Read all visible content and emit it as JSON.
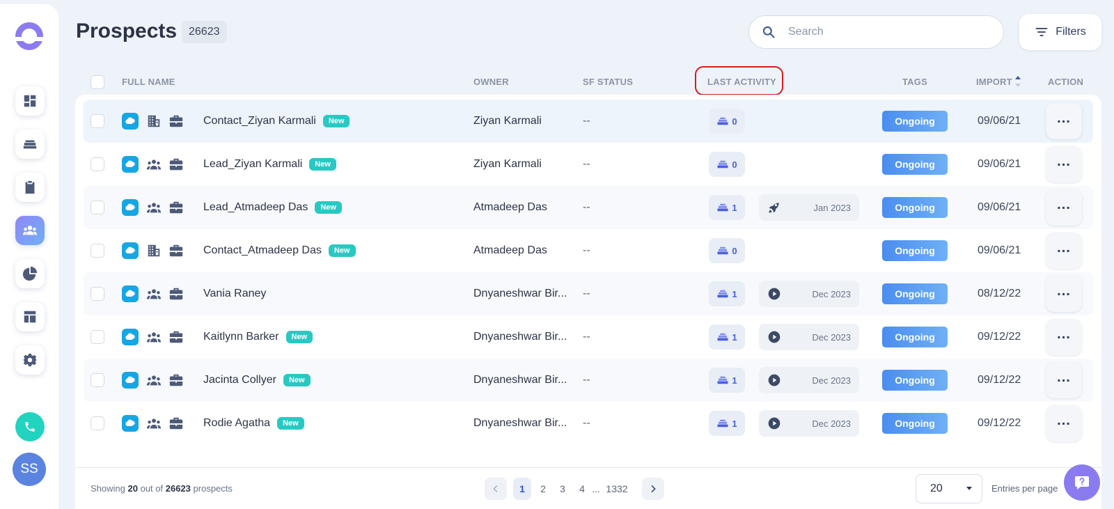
{
  "header": {
    "title": "Prospects",
    "count": "26623",
    "search_placeholder": "Search",
    "filters_label": "Filters"
  },
  "sidebar": {
    "items": [
      {
        "icon": "dashboard-icon",
        "active": false
      },
      {
        "icon": "stack-icon",
        "active": false
      },
      {
        "icon": "clipboard-icon",
        "active": false
      },
      {
        "icon": "people-icon",
        "active": true
      },
      {
        "icon": "pie-chart-icon",
        "active": false
      },
      {
        "icon": "layout-icon",
        "active": false
      },
      {
        "icon": "gear-icon",
        "active": false
      }
    ],
    "avatar_initials": "SS"
  },
  "table": {
    "columns": {
      "full_name": "FULL NAME",
      "owner": "OWNER",
      "sf_status": "SF STATUS",
      "last_activity": "LAST ACTIVITY",
      "tags": "TAGS",
      "import": "IMPORT",
      "action": "ACTION"
    },
    "new_label": "New",
    "rows": [
      {
        "type": "contact",
        "name": "Contact_Ziyan Karmali",
        "is_new": true,
        "owner": "Ziyan Karmali",
        "sf_status": "--",
        "activity_count": "0",
        "last_activity": "",
        "last_activity_icon": "",
        "tag": "Ongoing",
        "import": "09/06/21"
      },
      {
        "type": "lead",
        "name": "Lead_Ziyan Karmali",
        "is_new": true,
        "owner": "Ziyan Karmali",
        "sf_status": "--",
        "activity_count": "0",
        "last_activity": "",
        "last_activity_icon": "",
        "tag": "Ongoing",
        "import": "09/06/21"
      },
      {
        "type": "lead",
        "name": "Lead_Atmadeep Das",
        "is_new": true,
        "owner": "Atmadeep Das",
        "sf_status": "--",
        "activity_count": "1",
        "last_activity": "Jan 2023",
        "last_activity_icon": "rocket-icon",
        "tag": "Ongoing",
        "import": "09/06/21"
      },
      {
        "type": "contact",
        "name": "Contact_Atmadeep Das",
        "is_new": true,
        "owner": "Atmadeep Das",
        "sf_status": "--",
        "activity_count": "0",
        "last_activity": "",
        "last_activity_icon": "",
        "tag": "Ongoing",
        "import": "09/06/21"
      },
      {
        "type": "lead",
        "name": "Vania Raney",
        "is_new": false,
        "owner": "Dnyaneshwar Bir...",
        "sf_status": "--",
        "activity_count": "1",
        "last_activity": "Dec 2023",
        "last_activity_icon": "play-icon",
        "tag": "Ongoing",
        "import": "08/12/22"
      },
      {
        "type": "lead",
        "name": "Kaitlynn Barker",
        "is_new": true,
        "owner": "Dnyaneshwar Bir...",
        "sf_status": "--",
        "activity_count": "1",
        "last_activity": "Dec 2023",
        "last_activity_icon": "play-icon",
        "tag": "Ongoing",
        "import": "09/12/22"
      },
      {
        "type": "lead",
        "name": "Jacinta Collyer",
        "is_new": true,
        "owner": "Dnyaneshwar Bir...",
        "sf_status": "--",
        "activity_count": "1",
        "last_activity": "Dec 2023",
        "last_activity_icon": "play-icon",
        "tag": "Ongoing",
        "import": "09/12/22"
      },
      {
        "type": "lead",
        "name": "Rodie Agatha",
        "is_new": true,
        "owner": "Dnyaneshwar Bir...",
        "sf_status": "--",
        "activity_count": "1",
        "last_activity": "Dec 2023",
        "last_activity_icon": "play-icon",
        "tag": "Ongoing",
        "import": "09/12/22"
      }
    ]
  },
  "footer": {
    "showing_prefix": "Showing",
    "showing_count": "20",
    "showing_mid": "out of",
    "showing_total": "26623",
    "showing_suffix": "prospects",
    "pages": [
      "1",
      "2",
      "3",
      "4"
    ],
    "ellipsis": "...",
    "last_page": "1332",
    "per_page": "20",
    "entries_label": "Entries per page"
  },
  "colors": {
    "accent": "#8a7cf0",
    "tag": "#4a8df0",
    "new_badge": "#28c9c3",
    "highlight_box": "#d81b1b"
  }
}
